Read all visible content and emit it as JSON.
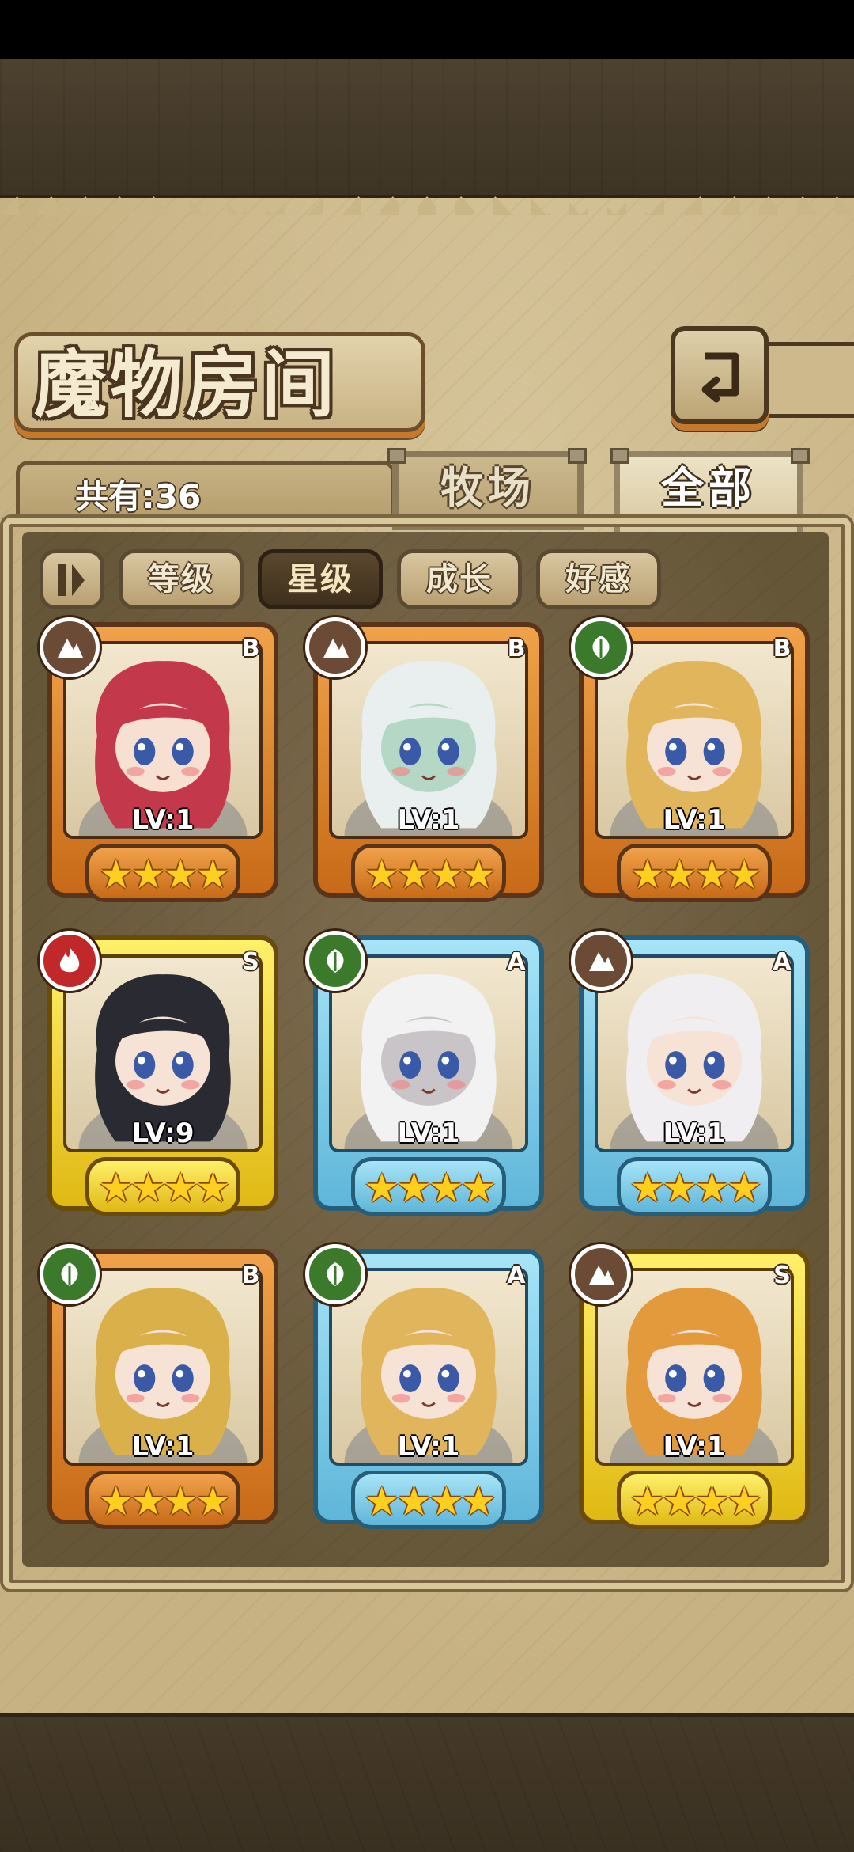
{
  "title": "魔物房间",
  "count_label": "共有:36",
  "tabs": [
    {
      "label": "牧场",
      "active": false
    },
    {
      "label": "全部",
      "active": true
    }
  ],
  "filters": [
    {
      "label": "等级",
      "active": false
    },
    {
      "label": "星级",
      "active": true
    },
    {
      "label": "成长",
      "active": false
    },
    {
      "label": "好感",
      "active": false
    }
  ],
  "colors": {
    "orange_frame": "#e58a2e",
    "blue_frame": "#8fd3ef",
    "gold_frame": "#f5d92e",
    "star": "#ffcf1f"
  },
  "monsters": [
    {
      "level": "LV:1",
      "rank": "B",
      "element": "earth",
      "stars": "★★★★",
      "hair": "#c3384a",
      "skin": "#f7dfd2"
    },
    {
      "level": "LV:1",
      "rank": "B",
      "element": "earth",
      "stars": "★★★★",
      "hair": "#e9efee",
      "skin": "#b5d8c6"
    },
    {
      "level": "LV:1",
      "rank": "B",
      "element": "nature",
      "stars": "★★★★",
      "hair": "#e0b55c",
      "skin": "#f7e3d5"
    },
    {
      "level": "LV:9",
      "rank": "S",
      "element": "fire",
      "stars": "★★★★",
      "hair": "#2a2a32",
      "skin": "#f7e3d5"
    },
    {
      "level": "LV:1",
      "rank": "A",
      "element": "nature",
      "stars": "★★★★",
      "hair": "#f2f2f2",
      "skin": "#c9c4c8"
    },
    {
      "level": "LV:1",
      "rank": "A",
      "element": "earth",
      "stars": "★★★★",
      "hair": "#f0eef0",
      "skin": "#f7e3d5"
    },
    {
      "level": "LV:1",
      "rank": "B",
      "element": "nature",
      "stars": "★★★★",
      "hair": "#d9b04a",
      "skin": "#f7e3d5"
    },
    {
      "level": "LV:1",
      "rank": "A",
      "element": "nature",
      "stars": "★★★★",
      "hair": "#e0b55c",
      "skin": "#f7e3d5"
    },
    {
      "level": "LV:1",
      "rank": "S",
      "element": "earth",
      "stars": "★★★★",
      "hair": "#e39a3c",
      "skin": "#f7e3d5"
    }
  ]
}
